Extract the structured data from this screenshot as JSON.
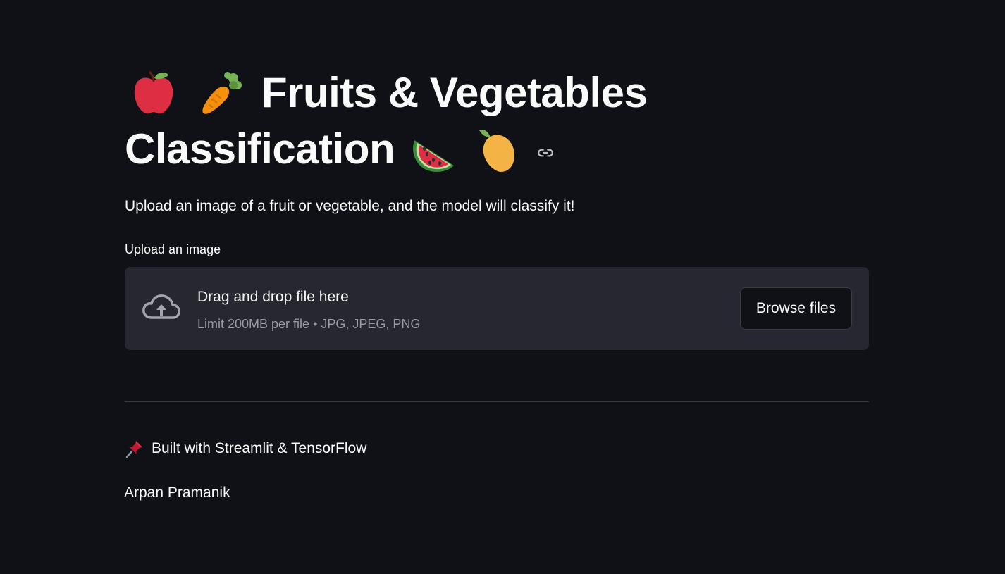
{
  "header": {
    "title_line1_text": "Fruits & Vegetables",
    "title_line2_text": "Classification",
    "title_emojis": [
      "apple-icon",
      "carrot-icon",
      "watermelon-icon",
      "mango-icon"
    ],
    "anchor_icon": "link-icon"
  },
  "main": {
    "subtitle": "Upload an image of a fruit or vegetable, and the model will classify it!",
    "uploader": {
      "label": "Upload an image",
      "dropzone_title": "Drag and drop file here",
      "dropzone_limits": "Limit 200MB per file • JPG, JPEG, PNG",
      "browse_button": "Browse files",
      "icon": "cloud-upload-icon"
    }
  },
  "footer": {
    "built_with": "Built with Streamlit & TensorFlow",
    "built_with_icon": "pushpin-icon",
    "author": "Arpan Pramanik"
  },
  "colors": {
    "background": "#0f1116",
    "text": "#fafafa",
    "muted_text": "#9a9ba3",
    "dropzone_bg": "#262730",
    "border": "#3a3b44"
  }
}
